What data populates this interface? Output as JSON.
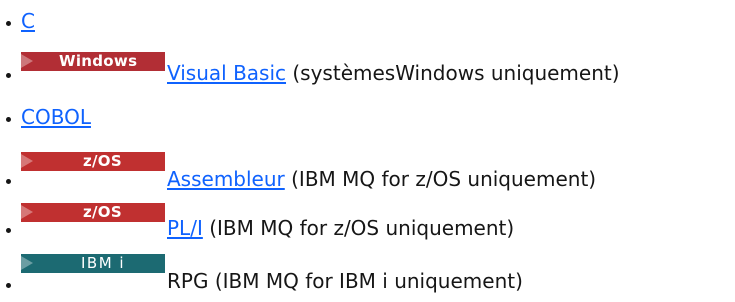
{
  "items": [
    {
      "link": "C"
    },
    {
      "badge": "Windows",
      "link": "Visual Basic",
      "suffix": " (systèmesWindows uniquement)"
    },
    {
      "link": "COBOL"
    },
    {
      "badge": "z/OS",
      "link": "Assembleur",
      "suffix": " (IBM MQ for z/OS uniquement)"
    },
    {
      "badge": "z/OS",
      "link": "PL/I",
      "suffix": " (IBM MQ for z/OS uniquement)"
    },
    {
      "badge": "IBM i",
      "prefix": "RPG (IBM MQ for IBM i uniquement)"
    }
  ],
  "colors": {
    "link": "#0f62fe",
    "windows_badge": "#b22e35",
    "zos_badge": "#c03030",
    "ibmi_badge": "#1c6a72"
  }
}
